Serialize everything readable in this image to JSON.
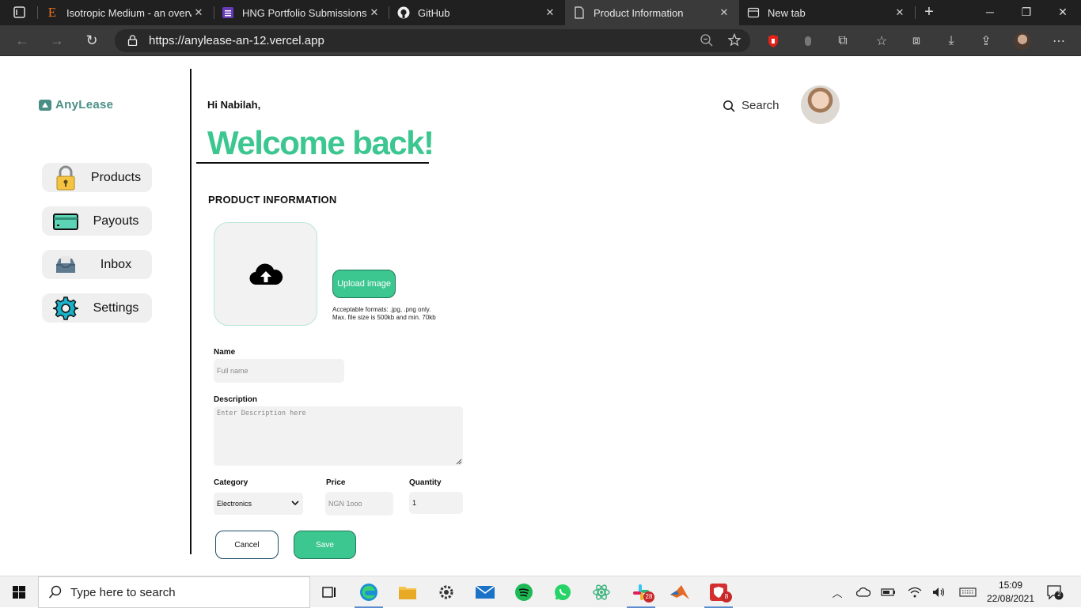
{
  "browser": {
    "tabs": [
      {
        "title": "Isotropic Medium - an overvi",
        "icon": "elsevier-e-icon"
      },
      {
        "title": "HNG Portfolio Submissions",
        "icon": "form-list-icon"
      },
      {
        "title": "GitHub",
        "icon": "github-icon"
      },
      {
        "title": "Product Information",
        "icon": "page-icon",
        "active": true
      },
      {
        "title": "New tab",
        "icon": "newtab-icon"
      }
    ],
    "url": "https://anylease-an-12.vercel.app"
  },
  "app": {
    "brand": "AnyLease",
    "sidebar": [
      {
        "label": "Products",
        "icon": "lock-icon"
      },
      {
        "label": "Payouts",
        "icon": "card-icon"
      },
      {
        "label": "Inbox",
        "icon": "inbox-icon"
      },
      {
        "label": "Settings",
        "icon": "gear-icon"
      }
    ],
    "greeting": "Hi Nabilah,",
    "welcome": "Welcome back!",
    "search_label": "Search"
  },
  "form": {
    "section_title": "PRODUCT INFORMATION",
    "upload_label": "Upload image",
    "hint_line1": "Acceptable formats: .jpg, .png only.",
    "hint_line2": "Max. file size is 500kb and min. 70kb",
    "name_label": "Name",
    "name_placeholder": "Full name",
    "description_label": "Description",
    "description_placeholder": "Enter Description here",
    "category_label": "Category",
    "category_value": "Electronics",
    "price_label": "Price",
    "price_placeholder": "NGN 1ooo",
    "quantity_label": "Quantity",
    "quantity_value": "1",
    "cancel_label": "Cancel",
    "save_label": "Save"
  },
  "taskbar": {
    "search_placeholder": "Type here to search",
    "time": "15:09",
    "date": "22/08/2021",
    "slack_badge": "28",
    "app_badge": "8",
    "notification_count": "2"
  },
  "colors": {
    "accent": "#3cc690",
    "brand": "#4a8f86"
  }
}
